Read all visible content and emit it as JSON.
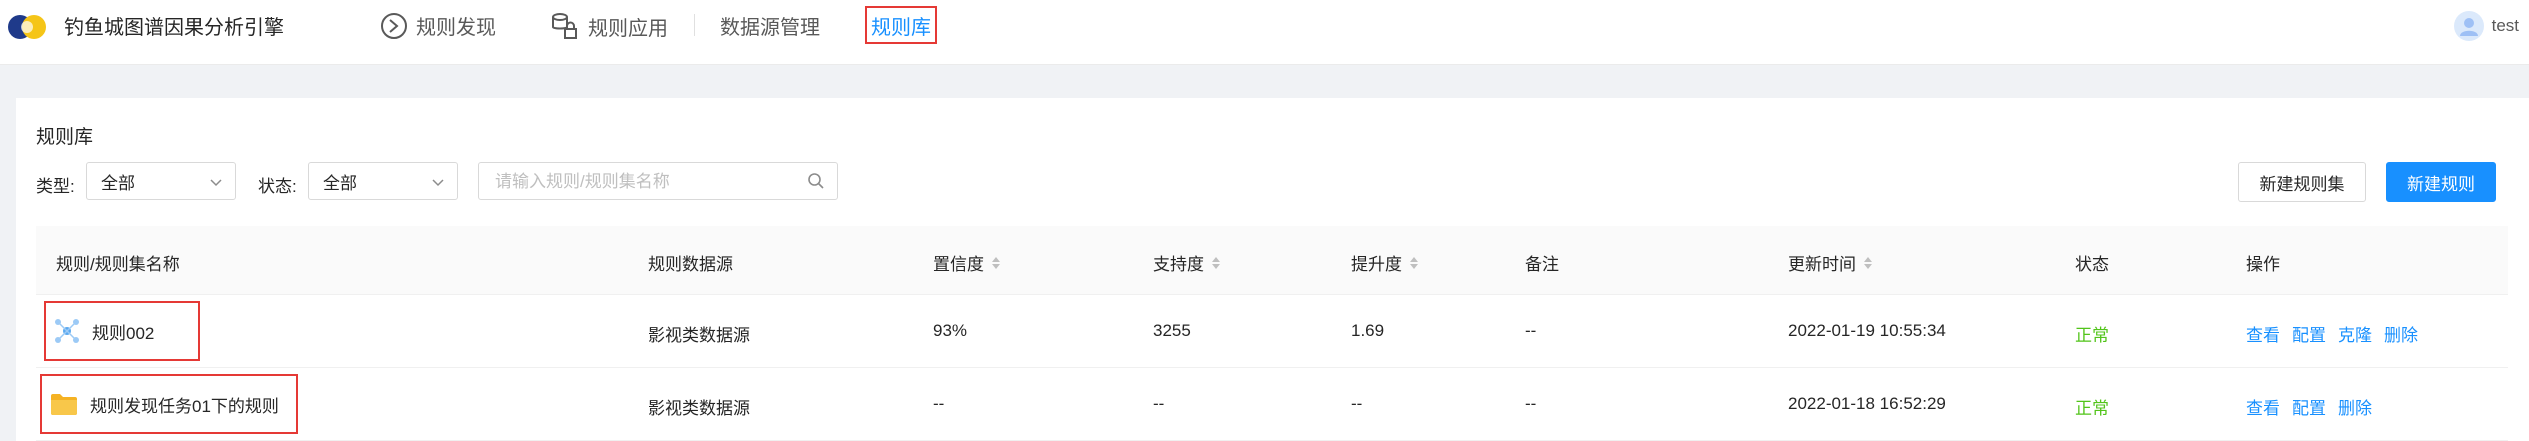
{
  "header": {
    "app_title": "钓鱼城图谱因果分析引擎",
    "nav": [
      {
        "label": "规则发现",
        "icon": "rule-discovery-icon"
      },
      {
        "label": "规则应用",
        "icon": "database-lock-icon"
      },
      {
        "label": "数据源管理",
        "icon": ""
      },
      {
        "label": "规则库",
        "icon": "",
        "active": true
      }
    ],
    "user": "test"
  },
  "card": {
    "title": "规则库",
    "filters": {
      "type_label": "类型:",
      "type_value": "全部",
      "status_label": "状态:",
      "status_value": "全部",
      "search_placeholder": "请输入规则/规则集名称"
    },
    "buttons": {
      "new_ruleset": "新建规则集",
      "new_rule": "新建规则"
    },
    "table": {
      "columns": [
        "规则/规则集名称",
        "规则数据源",
        "置信度",
        "支持度",
        "提升度",
        "备注",
        "更新时间",
        "状态",
        "操作"
      ],
      "rows": [
        {
          "icon": "rule-graph-icon",
          "name": "规则002",
          "source": "影视类数据源",
          "confidence": "93%",
          "support": "3255",
          "lift": "1.69",
          "note": "--",
          "updated": "2022-01-19 10:55:34",
          "status": "正常",
          "ops": [
            "查看",
            "配置",
            "克隆",
            "删除"
          ]
        },
        {
          "icon": "folder-icon",
          "name": "规则发现任务01下的规则",
          "source": "影视类数据源",
          "confidence": "--",
          "support": "--",
          "lift": "--",
          "note": "--",
          "updated": "2022-01-18 16:52:29",
          "status": "正常",
          "ops": [
            "查看",
            "配置",
            "删除"
          ]
        }
      ]
    }
  },
  "colors": {
    "primary": "#1890ff",
    "success": "#52c41a",
    "highlight": "#e53935",
    "folder": "#f5b223"
  }
}
